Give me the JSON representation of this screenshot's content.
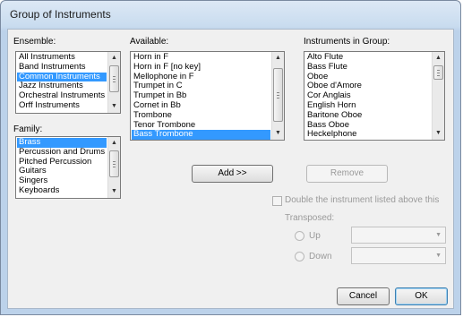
{
  "window": {
    "title": "Group of Instruments"
  },
  "ensemble": {
    "label": "Ensemble:",
    "items": [
      "All Instruments",
      "Band Instruments",
      "Common Instruments",
      "Jazz Instruments",
      "Orchestral Instruments",
      "Orff Instruments"
    ],
    "selected": "Common Instruments"
  },
  "family": {
    "label": "Family:",
    "items": [
      "Brass",
      "Percussion and Drums",
      "Pitched Percussion",
      "Guitars",
      "Singers",
      "Keyboards"
    ],
    "selected": "Brass"
  },
  "available": {
    "label": "Available:",
    "items": [
      "Horn in F",
      "Horn in F [no key]",
      "Mellophone in F",
      "Trumpet in C",
      "Trumpet in Bb",
      "Cornet in Bb",
      "Trombone",
      "Tenor Trombone",
      "Bass Trombone"
    ],
    "selected": "Bass Trombone"
  },
  "group": {
    "label": "Instruments in Group:",
    "items": [
      "Alto Flute",
      "Bass Flute",
      "Oboe",
      "Oboe d'Amore",
      "Cor Anglais",
      "English Horn",
      "Baritone Oboe",
      "Bass Oboe",
      "Heckelphone"
    ]
  },
  "buttons": {
    "add": "Add >>",
    "remove": "Remove",
    "cancel": "Cancel",
    "ok": "OK"
  },
  "double": {
    "label": "Double the instrument listed above this"
  },
  "transposed": {
    "label": "Transposed:",
    "up": "Up",
    "down": "Down"
  }
}
